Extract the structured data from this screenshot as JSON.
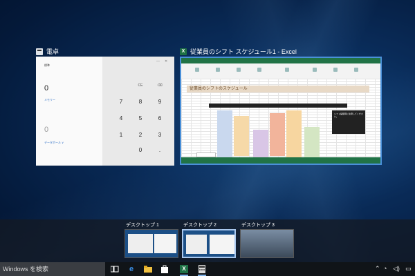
{
  "windows": {
    "calculator": {
      "title": "電卓",
      "mode": "標準",
      "display_value": "0",
      "history_link": "メモリー",
      "secondary_value": "0",
      "memory_link": "データボール ∨",
      "keys": [
        "CE",
        "⌫",
        "7",
        "8",
        "9",
        "4",
        "5",
        "6",
        "1",
        "2",
        "3",
        "0",
        "."
      ]
    },
    "excel": {
      "title": "従業員のシフト スケジュール1 - Excel",
      "sheet_header": "従業員のシフトのスケジュール",
      "callout_text": "シフト編集時に注意してください。"
    }
  },
  "desktops": [
    {
      "label": "デスクトップ 1"
    },
    {
      "label": "デスクトップ 2"
    },
    {
      "label": "デスクトップ 3"
    }
  ],
  "taskbar": {
    "search_placeholder": "Windows を検索"
  },
  "colors": {
    "excel_green": "#217346",
    "accent": "#2b6cc4"
  }
}
